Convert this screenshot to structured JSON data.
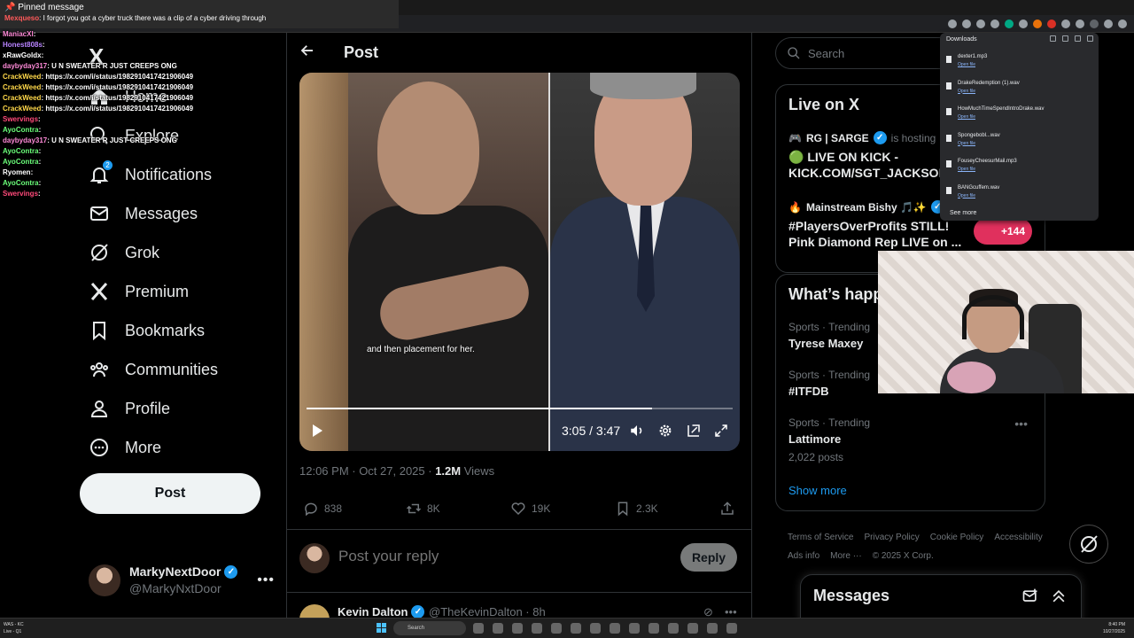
{
  "chat": {
    "pinned_title": "Pinned message",
    "pinned_user": "Mexqueso",
    "pinned_text": ": I forgot you got a cyber truck there was a clip of a cyber driving through",
    "lines": [
      {
        "user": "ManiacXI",
        "text": ":",
        "color": "#ff8ad8"
      },
      {
        "user": "Honest808s",
        "text": ":",
        "color": "#b883ff"
      },
      {
        "user": "xRawGoldx",
        "text": ":",
        "color": "#ffffff"
      },
      {
        "user": "daybyday317",
        "text": ": U N SWEATER R JUST CREEPS ONG",
        "color": "#ff8ad8"
      },
      {
        "user": "CrackWeed",
        "text": ": https://x.com/i/status/1982910417421906049",
        "color": "#ffd84a"
      },
      {
        "user": "CrackWeed",
        "text": ": https://x.com/i/status/1982910417421906049",
        "color": "#ffd84a"
      },
      {
        "user": "CrackWeed",
        "text": ": https://x.com/i/status/1982910417421906049",
        "color": "#ffd84a"
      },
      {
        "user": "CrackWeed",
        "text": ": https://x.com/i/status/1982910417421906049",
        "color": "#ffd84a"
      },
      {
        "user": "Swervings",
        "text": ":",
        "color": "#ff4a7a"
      },
      {
        "user": "AyoContra",
        "text": ":",
        "color": "#6bff7a"
      },
      {
        "user": "daybyday317",
        "text": ": U N SWEATER R JUST CREEPS ONG",
        "color": "#ff8ad8"
      },
      {
        "user": "AyoContra",
        "text": ":",
        "color": "#6bff7a"
      },
      {
        "user": "AyoContra",
        "text": ":",
        "color": "#6bff7a"
      },
      {
        "user": "Ryomen",
        "text": ":",
        "color": "#ffffff"
      },
      {
        "user": "AyoContra",
        "text": ":",
        "color": "#6bff7a"
      },
      {
        "user": "Swervings",
        "text": ":",
        "color": "#ff4a7a"
      }
    ]
  },
  "nav": {
    "logo": "X",
    "items": [
      {
        "label": "Home"
      },
      {
        "label": "Explore"
      },
      {
        "label": "Notifications",
        "badge": "2"
      },
      {
        "label": "Messages"
      },
      {
        "label": "Grok"
      },
      {
        "label": "Premium"
      },
      {
        "label": "Bookmarks"
      },
      {
        "label": "Communities"
      },
      {
        "label": "Profile"
      },
      {
        "label": "More"
      }
    ],
    "post_button": "Post",
    "account": {
      "name": "MarkyNextDoor",
      "handle": "@MarkyNxtDoor"
    }
  },
  "post": {
    "header_title": "Post",
    "subtitle_caption": "and then placement for her.",
    "video_time": "3:05 / 3:47",
    "progress_fraction": 0.81,
    "buffer_fraction": 0.81,
    "meta_time": "12:06 PM · Oct 27, 2025 · ",
    "meta_views": "1.2M",
    "meta_views_label": " Views",
    "replies": "838",
    "reposts": "8K",
    "likes": "19K",
    "bookmarks": "2.3K",
    "reply_placeholder": "Post your reply",
    "reply_button": "Reply",
    "next_author": "Kevin Dalton",
    "next_handle": "@TheKevinDalton · 8h"
  },
  "right": {
    "search_placeholder": "Search",
    "live_title": "Live on X",
    "live": [
      {
        "host": "RG | SARGE",
        "host_suffix": "is hosting",
        "text1": "🟢 LIVE ON KICK -",
        "text2": "KICK.COM/SGT_JACKSON A"
      },
      {
        "host": "Mainstream Bishy 🎵✨",
        "host_suffix": "",
        "text1": "#PlayersOverProfits STILL!",
        "text2": "Pink Diamond Rep LIVE on ..."
      }
    ],
    "live_count": "+144",
    "trends_title": "What’s happening",
    "trends": [
      {
        "category": "Sports · Trending",
        "name": "Tyrese Maxey",
        "posts": ""
      },
      {
        "category": "Sports · Trending",
        "name": "#ITFDB",
        "posts": ""
      },
      {
        "category": "Sports · Trending",
        "name": "Lattimore",
        "posts": "2,022 posts"
      }
    ],
    "show_more": "Show more",
    "footer": [
      "Terms of Service",
      "Privacy Policy",
      "Cookie Policy",
      "Accessibility",
      "Ads info",
      "More ···",
      "© 2025 X Corp."
    ],
    "messages_title": "Messages"
  },
  "downloads": {
    "title": "Downloads",
    "items": [
      {
        "name": "dexter1.mp3",
        "action": "Open file"
      },
      {
        "name": "DrakeRedemption (1).wav",
        "action": "Open file"
      },
      {
        "name": "HowMuchTimeSpendIntroDrake.wav",
        "action": "Open file"
      },
      {
        "name": "Spongebobl...wav",
        "action": "Open file"
      },
      {
        "name": "FouseyCheesurMail.mp3",
        "action": "Open file"
      },
      {
        "name": "BANGcuffem.wav",
        "action": "Open file"
      }
    ],
    "see_more": "See more"
  },
  "taskbar": {
    "left_line1": "WAS - KC",
    "left_line2": "Live - Q1",
    "search": "Search",
    "time": "8:40 PM",
    "date": "10/27/2025"
  }
}
